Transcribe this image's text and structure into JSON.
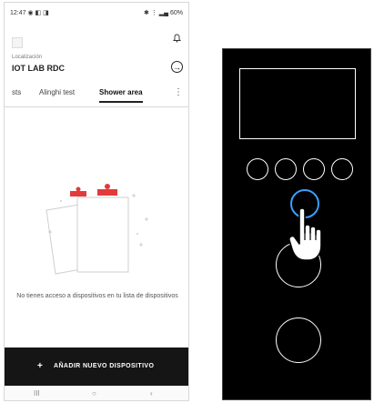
{
  "statusbar": {
    "time": "12:47 ◉ ◧ ◨",
    "right": "✱ ⋮ ▂▄ 60%"
  },
  "header": {
    "location_label": "Localización",
    "location_name": "IOT LAB RDC"
  },
  "tabs": [
    {
      "label": "sts"
    },
    {
      "label": "Alinghi test"
    },
    {
      "label": "Shower area"
    }
  ],
  "tab_more": "⋮",
  "empty_state": {
    "message": "No tienes acceso a dispositivos en tu lista de dispositivos"
  },
  "add_device": {
    "plus": "+",
    "label": "AÑADIR NUEVO DISPOSITIVO"
  },
  "navbar": {
    "recents": "III",
    "home": "○",
    "back": "‹"
  },
  "colors": {
    "highlight": "#3aa0ff",
    "accent_red": "#e23b3b",
    "bar": "#151515"
  },
  "icons": [
    "menu-icon",
    "bell-icon",
    "logout-icon",
    "clipboard-illustration",
    "hand-pointer-icon"
  ]
}
